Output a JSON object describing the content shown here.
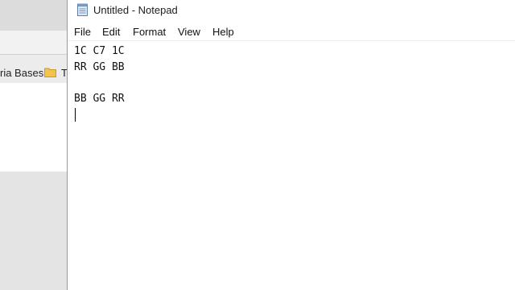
{
  "background_window": {
    "bookmark_partial_label": "ria Bases",
    "bookmark_next_partial_label": "T"
  },
  "notepad": {
    "title": "Untitled - Notepad",
    "menu": [
      "File",
      "Edit",
      "Format",
      "View",
      "Help"
    ],
    "lines": [
      "1C C7 1C",
      "RR GG BB",
      "",
      "BB GG RR",
      ""
    ]
  },
  "colors": {
    "folder": "#f2c34d",
    "background_window": "#ececec",
    "notepad_bg": "#ffffff"
  },
  "icons": [
    "notepad-app-icon",
    "folder-icon"
  ]
}
